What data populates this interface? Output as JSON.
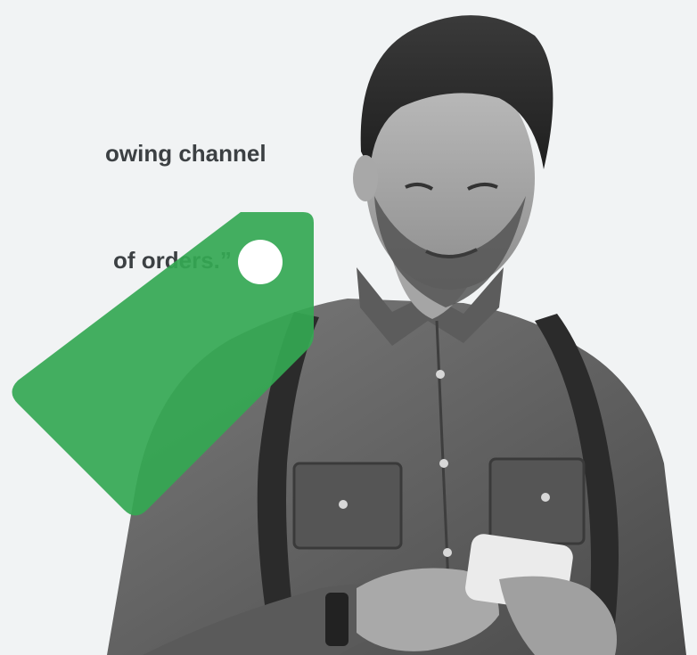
{
  "quote": {
    "line1": "owing channel",
    "line2": "of orders.”"
  },
  "colors": {
    "background": "#f1f3f4",
    "tag_green": "#34a853",
    "quote_text": "#3c4043"
  },
  "icons": {
    "tag": "price-tag-icon"
  }
}
